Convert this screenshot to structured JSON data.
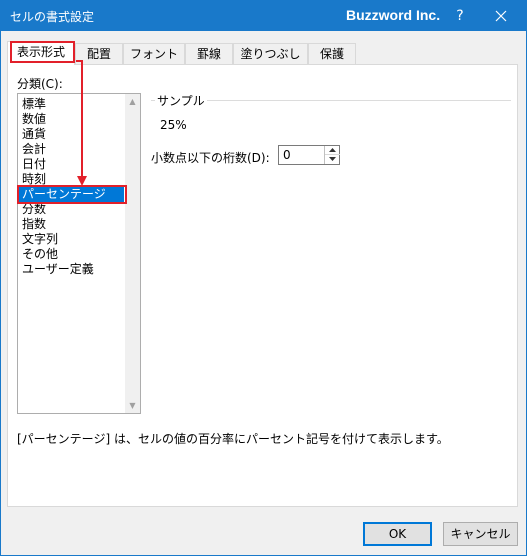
{
  "window": {
    "title": "セルの書式設定",
    "brand": "Buzzword Inc.",
    "help_label": "?"
  },
  "tabs": [
    {
      "label": "表示形式",
      "active": true
    },
    {
      "label": "配置",
      "active": false
    },
    {
      "label": "フォント",
      "active": false
    },
    {
      "label": "罫線",
      "active": false
    },
    {
      "label": "塗りつぶし",
      "active": false
    },
    {
      "label": "保護",
      "active": false
    }
  ],
  "category": {
    "label": "分類(C):",
    "items": [
      "標準",
      "数値",
      "通貨",
      "会計",
      "日付",
      "時刻",
      "パーセンテージ",
      "分数",
      "指数",
      "文字列",
      "その他",
      "ユーザー定義"
    ],
    "selected": "パーセンテージ"
  },
  "sample": {
    "legend": "サンプル",
    "value": "25%"
  },
  "decimals": {
    "label": "小数点以下の桁数(D):",
    "value": "0"
  },
  "description": "[パーセンテージ] は、セルの値の百分率にパーセント記号を付けて表示します。",
  "buttons": {
    "ok": "OK",
    "cancel": "キャンセル"
  },
  "colors": {
    "titlebar": "#1979ca",
    "selection": "#0078d7",
    "highlight": "#e2202a"
  },
  "icons": [
    "close-icon",
    "help-icon",
    "scroll-up-icon",
    "scroll-down-icon",
    "spin-up-icon",
    "spin-down-icon",
    "annotation-arrow-icon"
  ]
}
